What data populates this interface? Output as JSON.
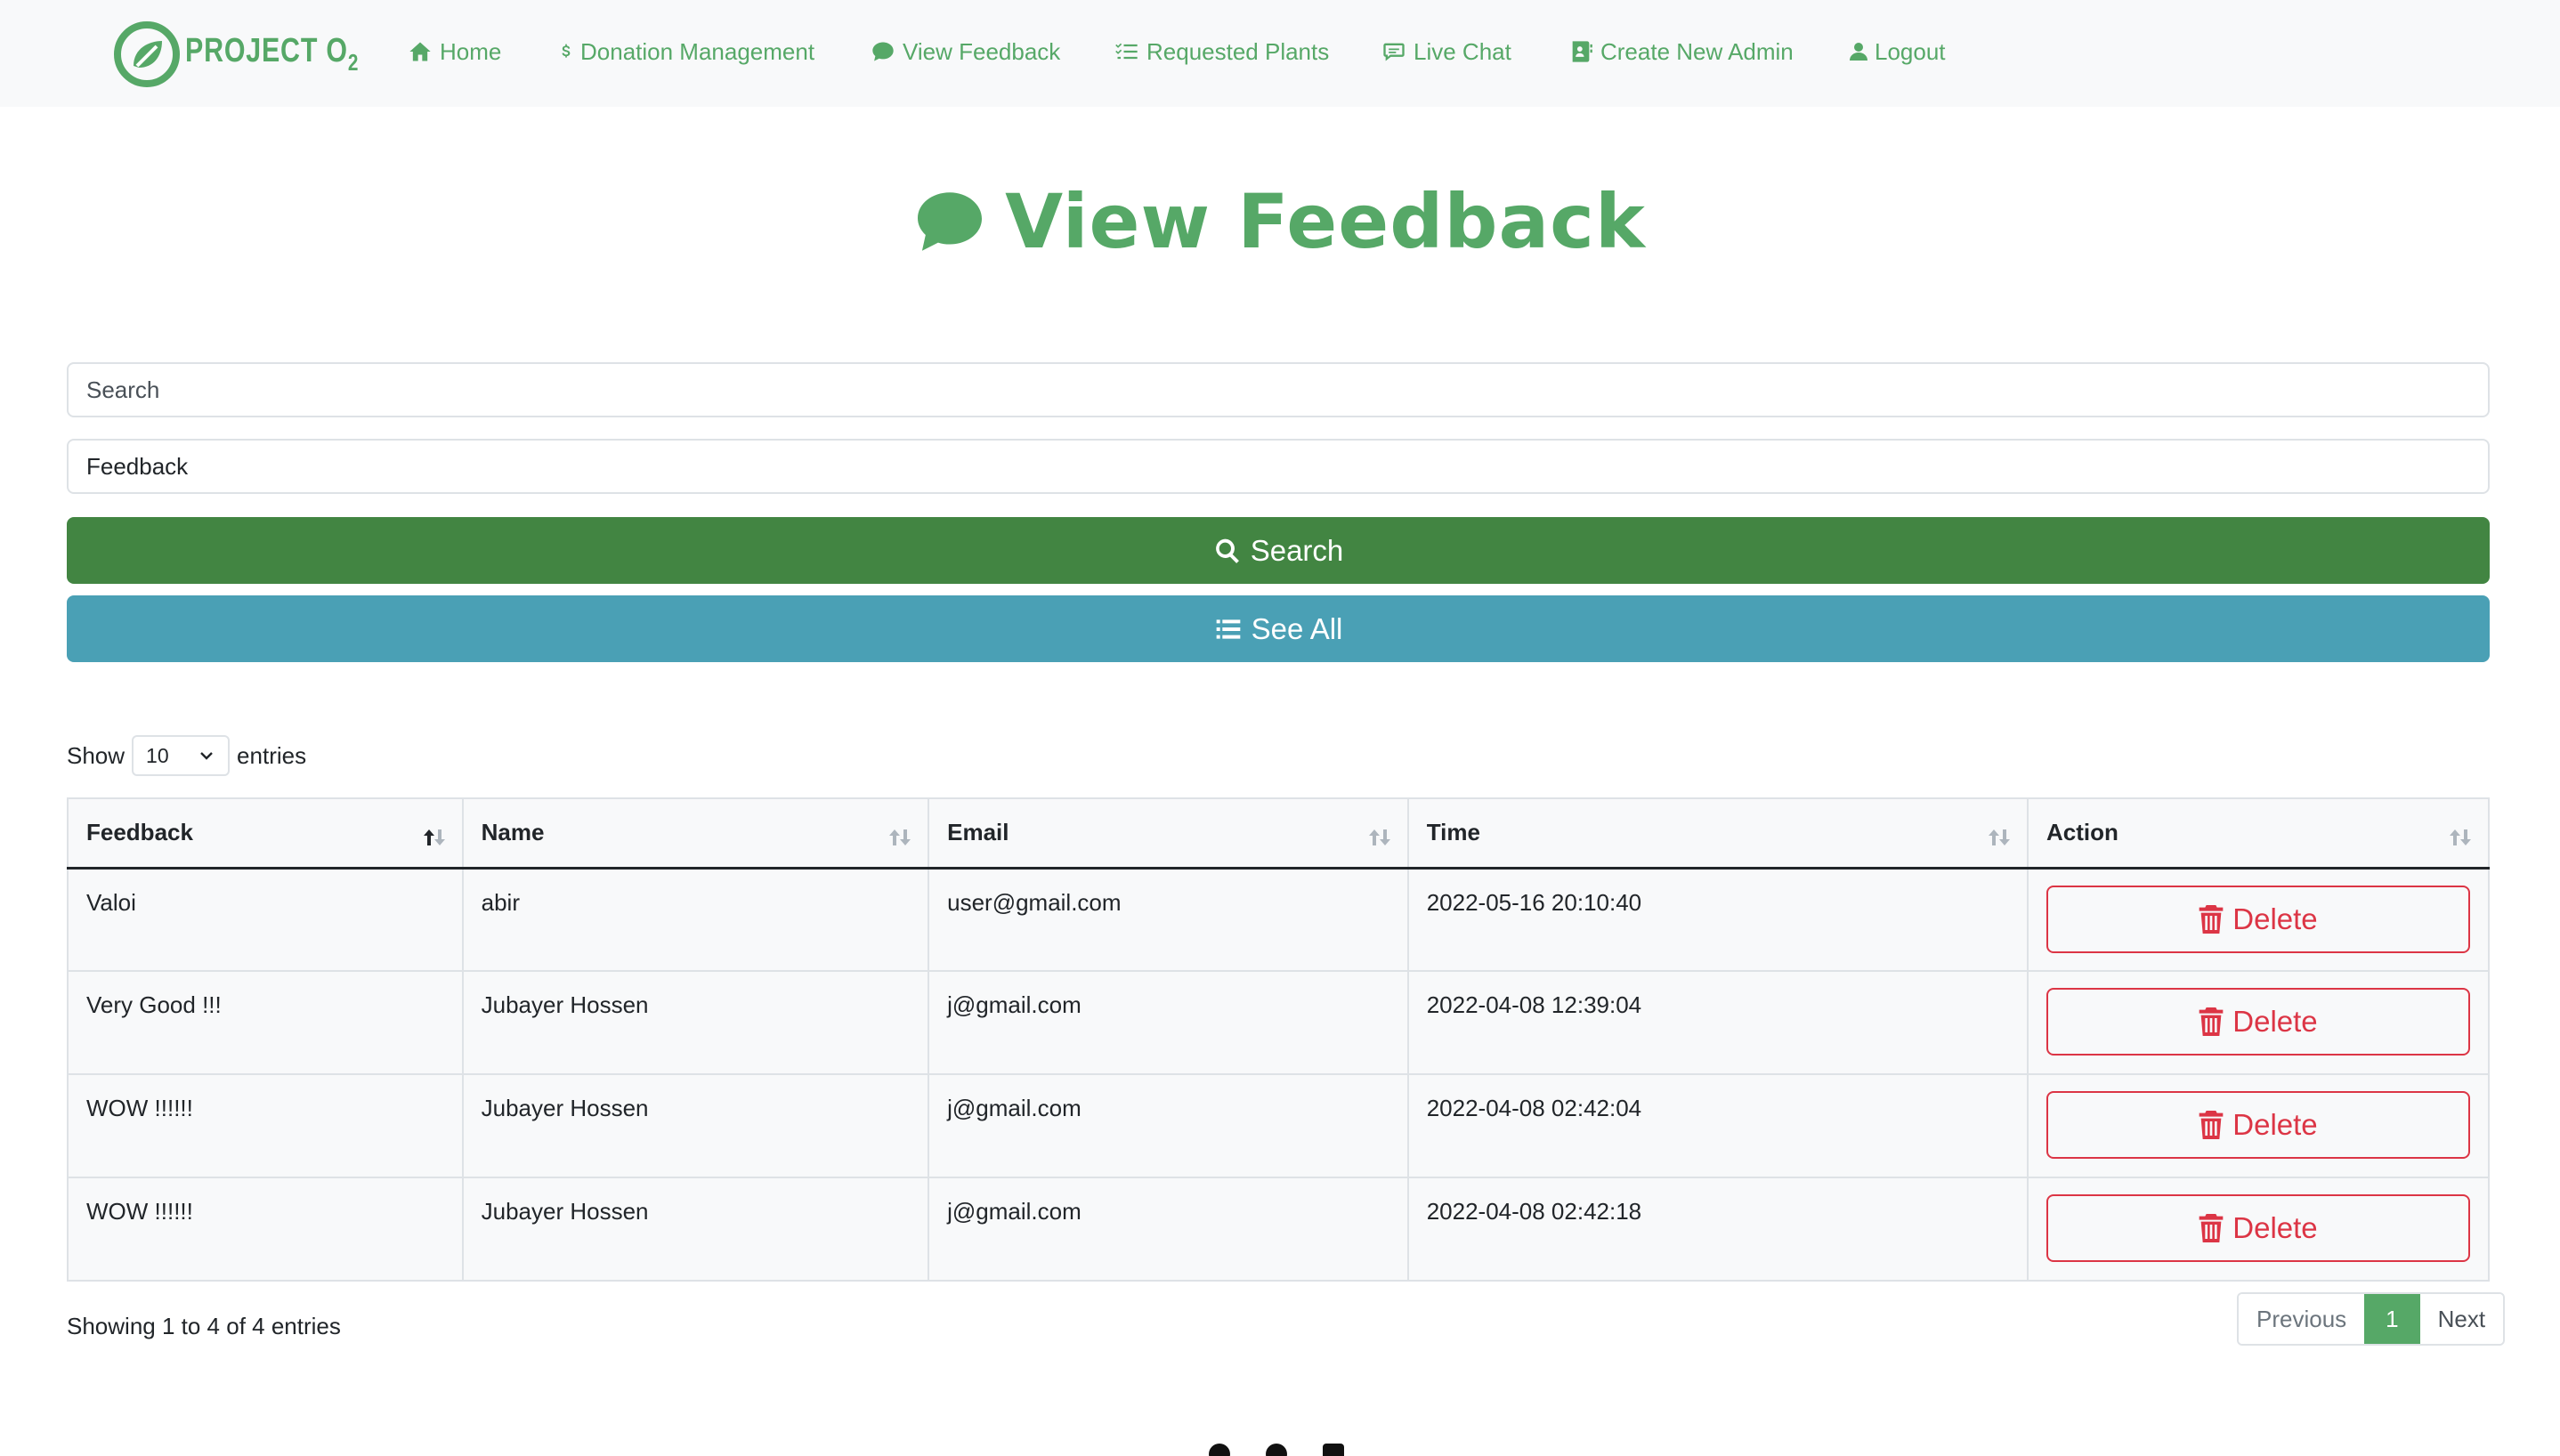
{
  "brand": {
    "name": "PROJECT O",
    "sub": "2"
  },
  "nav": {
    "home": "Home",
    "donation": "Donation Management",
    "feedback": "View Feedback",
    "plants": "Requested Plants",
    "chat": "Live Chat",
    "admin": "Create New Admin",
    "logout": "Logout"
  },
  "page": {
    "title": "View Feedback"
  },
  "form": {
    "search_placeholder": "Search",
    "feedback_value": "Feedback",
    "search_button": "Search",
    "see_all_button": "See All"
  },
  "entries": {
    "show": "Show",
    "value": "10",
    "suffix": "entries"
  },
  "table": {
    "headers": [
      "Feedback",
      "Name",
      "Email",
      "Time",
      "Action"
    ],
    "rows": [
      {
        "feedback": "Valoi",
        "name": "abir",
        "email": "user@gmail.com",
        "time": "2022-05-16 20:10:40",
        "action": "Delete"
      },
      {
        "feedback": "Very Good !!!",
        "name": "Jubayer Hossen",
        "email": "j@gmail.com",
        "time": "2022-04-08 12:39:04",
        "action": "Delete"
      },
      {
        "feedback": "WOW !!!!!!",
        "name": "Jubayer Hossen",
        "email": "j@gmail.com",
        "time": "2022-04-08 02:42:04",
        "action": "Delete"
      },
      {
        "feedback": "WOW !!!!!!",
        "name": "Jubayer Hossen",
        "email": "j@gmail.com",
        "time": "2022-04-08 02:42:18",
        "action": "Delete"
      }
    ]
  },
  "info": "Showing 1 to 4 of 4 entries",
  "pagination": {
    "previous": "Previous",
    "current": "1",
    "next": "Next"
  },
  "colors": {
    "brand": "#56a867",
    "search": "#428542",
    "see_all": "#4aa0b5",
    "danger": "#dc3545"
  }
}
